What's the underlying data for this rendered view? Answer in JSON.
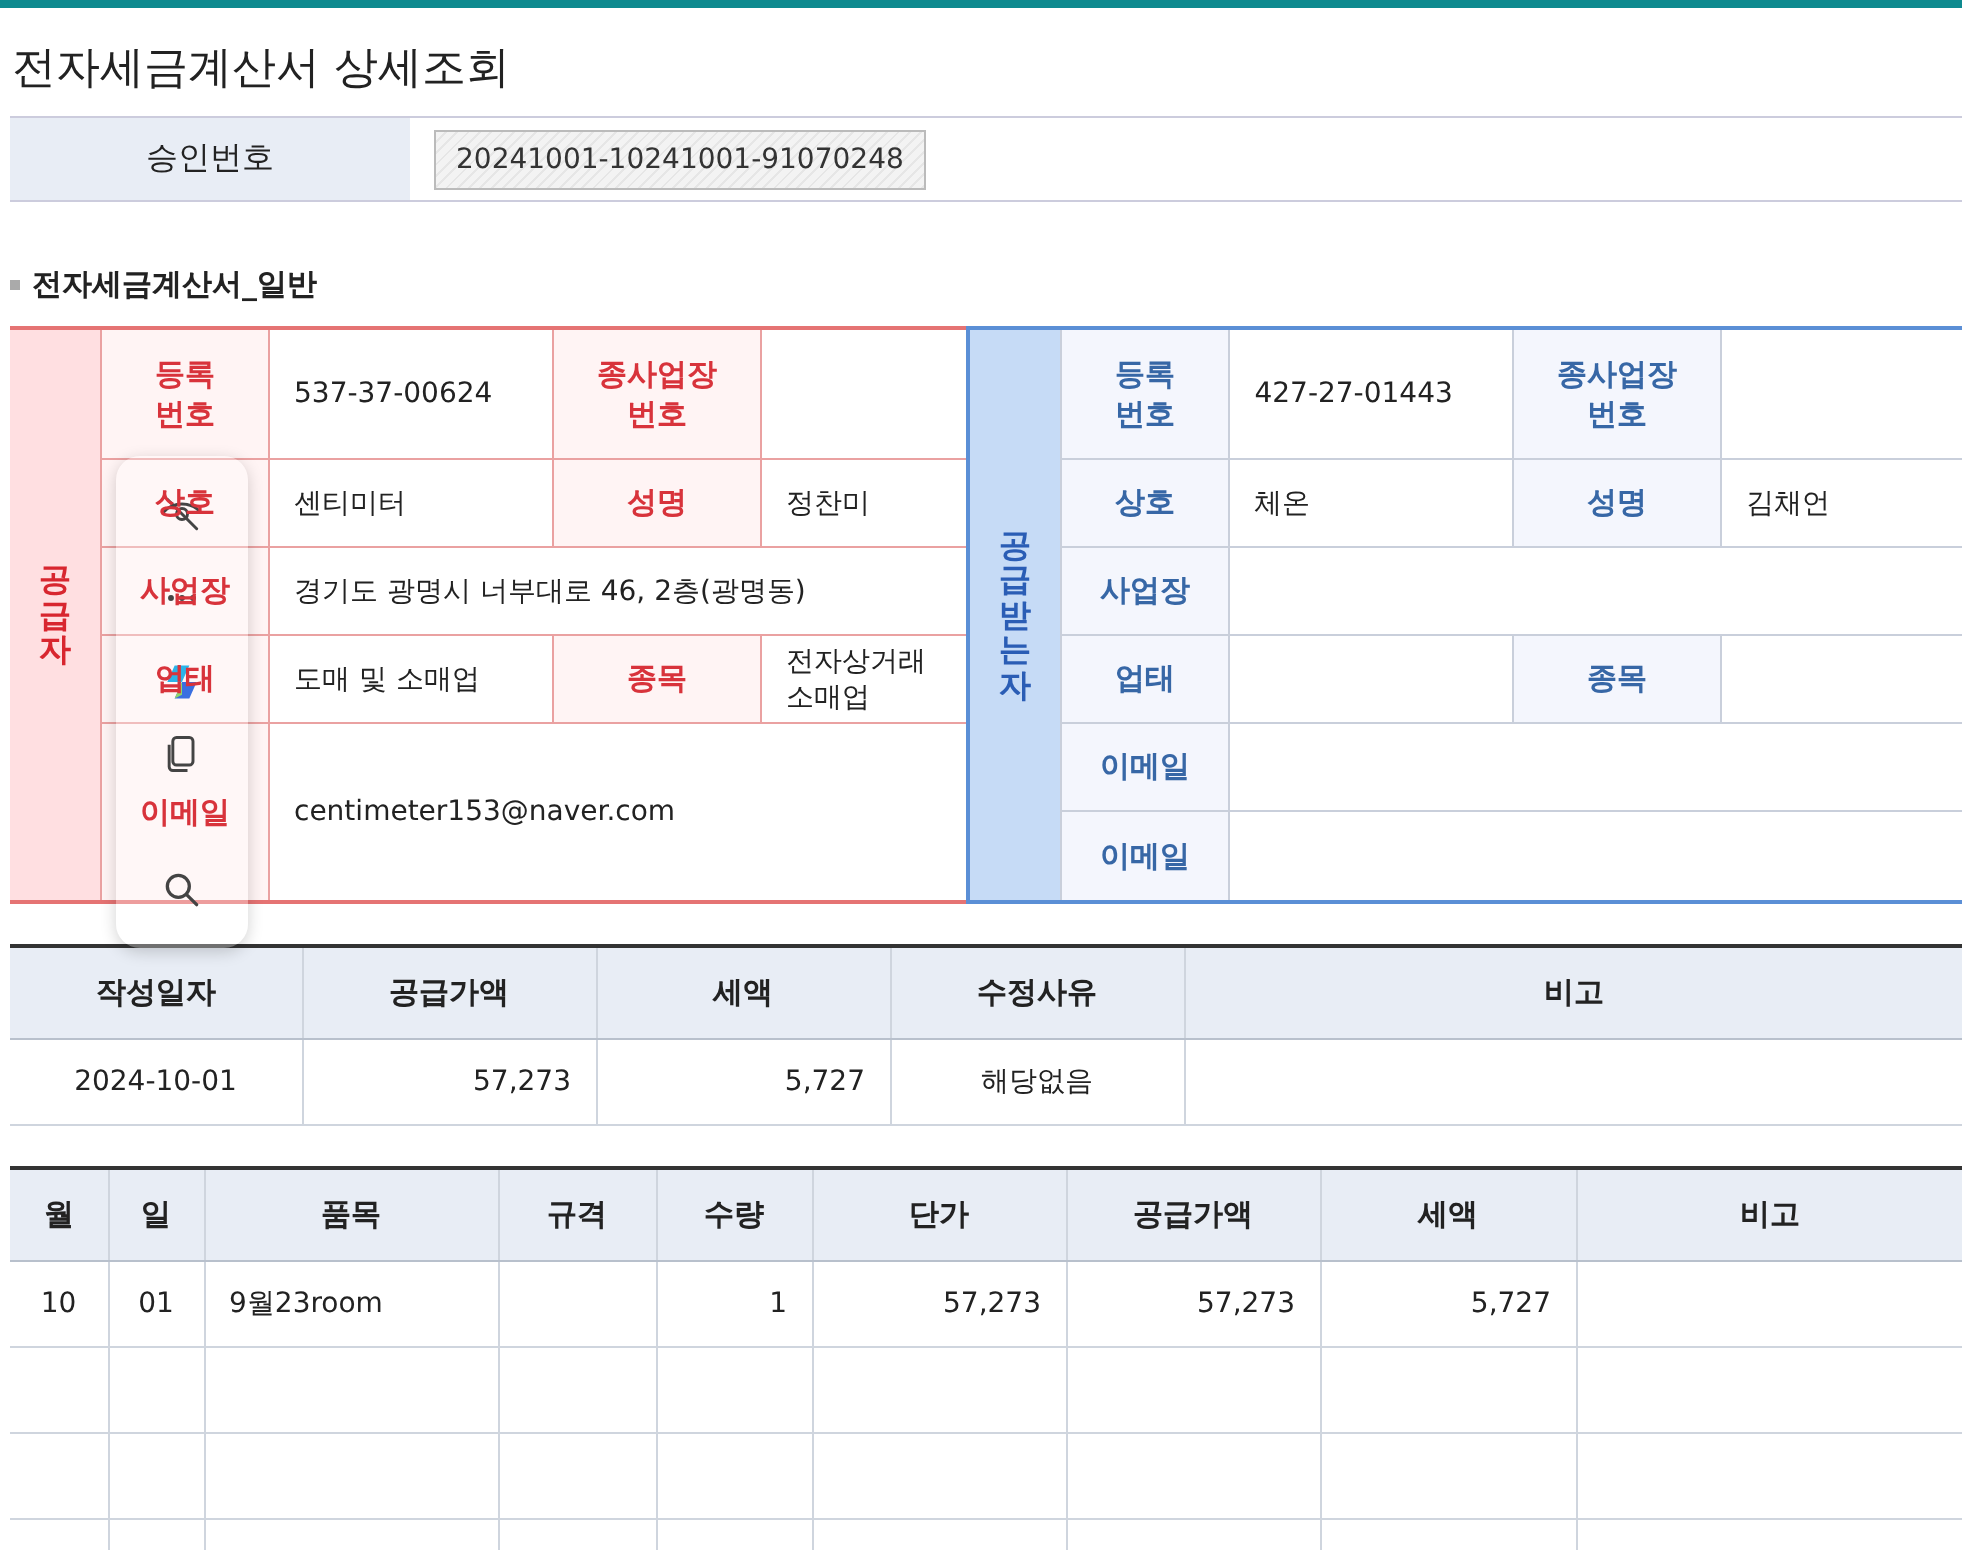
{
  "title": "전자세금계산서 상세조회",
  "approval": {
    "label": "승인번호",
    "value": "20241001-10241001-91070248"
  },
  "section_title": "전자세금계산서_일반",
  "parties": [
    {
      "kind": "supplier",
      "side_label": "공급자",
      "rows": [
        [
          {
            "kind": "label",
            "text": "등록 번호"
          },
          {
            "kind": "value",
            "text": "537-37-00624"
          },
          {
            "kind": "label",
            "text": "종사업장 번호"
          },
          {
            "kind": "value"
          }
        ],
        [
          {
            "kind": "label",
            "text": "상호"
          },
          {
            "kind": "value",
            "text": "센티미터"
          },
          {
            "kind": "label",
            "text": "성명"
          },
          {
            "kind": "value",
            "text": "정찬미"
          }
        ],
        [
          {
            "kind": "label",
            "text": "사업장"
          },
          {
            "kind": "value",
            "text": "경기도 광명시 너부대로 46, 2층(광명동)"
          }
        ],
        [
          {
            "kind": "label",
            "text": "업태"
          },
          {
            "kind": "value",
            "text": "도매 및 소매업"
          },
          {
            "kind": "label",
            "text": "종목"
          },
          {
            "kind": "value",
            "text": "전자상거래 소매업"
          }
        ],
        [
          {
            "kind": "label",
            "text": "이메일"
          },
          {
            "kind": "value",
            "text": "centimeter153@naver.com"
          }
        ]
      ]
    },
    {
      "kind": "receiver",
      "side_label": "공급받는자",
      "rows": [
        [
          {
            "kind": "label",
            "text": "등록 번호"
          },
          {
            "kind": "value",
            "text": "427-27-01443"
          },
          {
            "kind": "label",
            "text": "종사업장 번호"
          },
          {
            "kind": "value"
          }
        ],
        [
          {
            "kind": "label",
            "text": "상호"
          },
          {
            "kind": "value",
            "text": "체온"
          },
          {
            "kind": "label",
            "text": "성명"
          },
          {
            "kind": "value",
            "text": "김채언"
          }
        ],
        [
          {
            "kind": "label",
            "text": "사업장"
          },
          {
            "kind": "value"
          }
        ],
        [
          {
            "kind": "label",
            "text": "업태"
          },
          {
            "kind": "value"
          },
          {
            "kind": "label",
            "text": "종목"
          },
          {
            "kind": "value"
          }
        ],
        [
          {
            "kind": "label",
            "text": "이메일"
          },
          {
            "kind": "value"
          }
        ],
        [
          {
            "kind": "label",
            "text": "이메일"
          },
          {
            "kind": "value"
          }
        ]
      ]
    }
  ],
  "summary_table": {
    "columns": [
      {
        "label": "작성일자",
        "kind": "code"
      },
      {
        "label": "공급가액",
        "kind": "number"
      },
      {
        "label": "세액",
        "kind": "number"
      },
      {
        "label": "수정사유",
        "kind": "code"
      },
      {
        "label": "비고",
        "kind": "text"
      }
    ],
    "rows": [
      {
        "kind": "item",
        "cells": [
          "2024-10-01",
          "57,273",
          "5,727",
          "해당없음",
          null
        ]
      }
    ]
  },
  "items_table": {
    "columns": [
      {
        "label": "월",
        "kind": "code"
      },
      {
        "label": "일",
        "kind": "code"
      },
      {
        "label": "품목",
        "kind": "text"
      },
      {
        "label": "규격",
        "kind": "text"
      },
      {
        "label": "수량",
        "kind": "number"
      },
      {
        "label": "단가",
        "kind": "number"
      },
      {
        "label": "공급가액",
        "kind": "number"
      },
      {
        "label": "세액",
        "kind": "number"
      },
      {
        "label": "비고",
        "kind": "text"
      }
    ],
    "rows": [
      {
        "kind": "item",
        "cells": [
          "10",
          "01",
          "9월23room",
          null,
          "1",
          "57,273",
          "57,273",
          "5,727",
          null
        ]
      },
      {
        "kind": "blank"
      },
      {
        "kind": "blank"
      },
      {
        "kind": "blank"
      }
    ]
  }
}
